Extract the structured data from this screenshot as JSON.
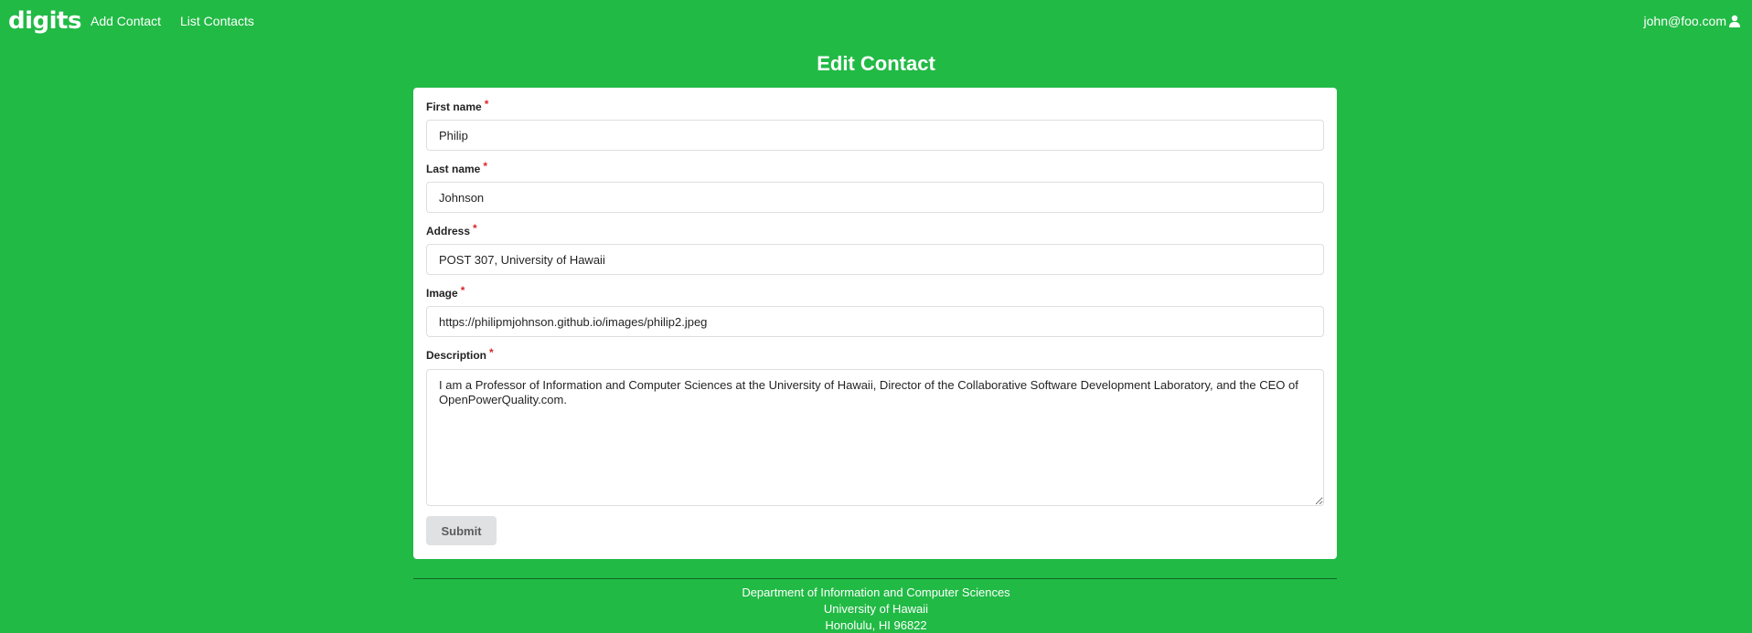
{
  "navbar": {
    "brand": "digits",
    "links": [
      "Add Contact",
      "List Contacts"
    ],
    "user": "john@foo.com",
    "user_icon": "user-icon"
  },
  "page": {
    "title": "Edit Contact"
  },
  "form": {
    "required_marker": "*",
    "fields": {
      "first_name": {
        "label": "First name",
        "value": "Philip"
      },
      "last_name": {
        "label": "Last name",
        "value": "Johnson"
      },
      "address": {
        "label": "Address",
        "value": "POST 307, University of Hawaii"
      },
      "image": {
        "label": "Image",
        "value": "https://philipmjohnson.github.io/images/philip2.jpeg"
      },
      "description": {
        "label": "Description",
        "value": "I am a Professor of Information and Computer Sciences at the University of Hawaii, Director of the Collaborative Software Development Laboratory, and the CEO of OpenPowerQuality.com."
      }
    },
    "submit_label": "Submit"
  },
  "footer": {
    "lines": [
      "Department of Information and Computer Sciences",
      "University of Hawaii",
      "Honolulu, HI 96822"
    ]
  },
  "colors": {
    "background": "#21ba45",
    "card": "#ffffff",
    "required": "#db2828",
    "button": "#e0e1e2"
  }
}
